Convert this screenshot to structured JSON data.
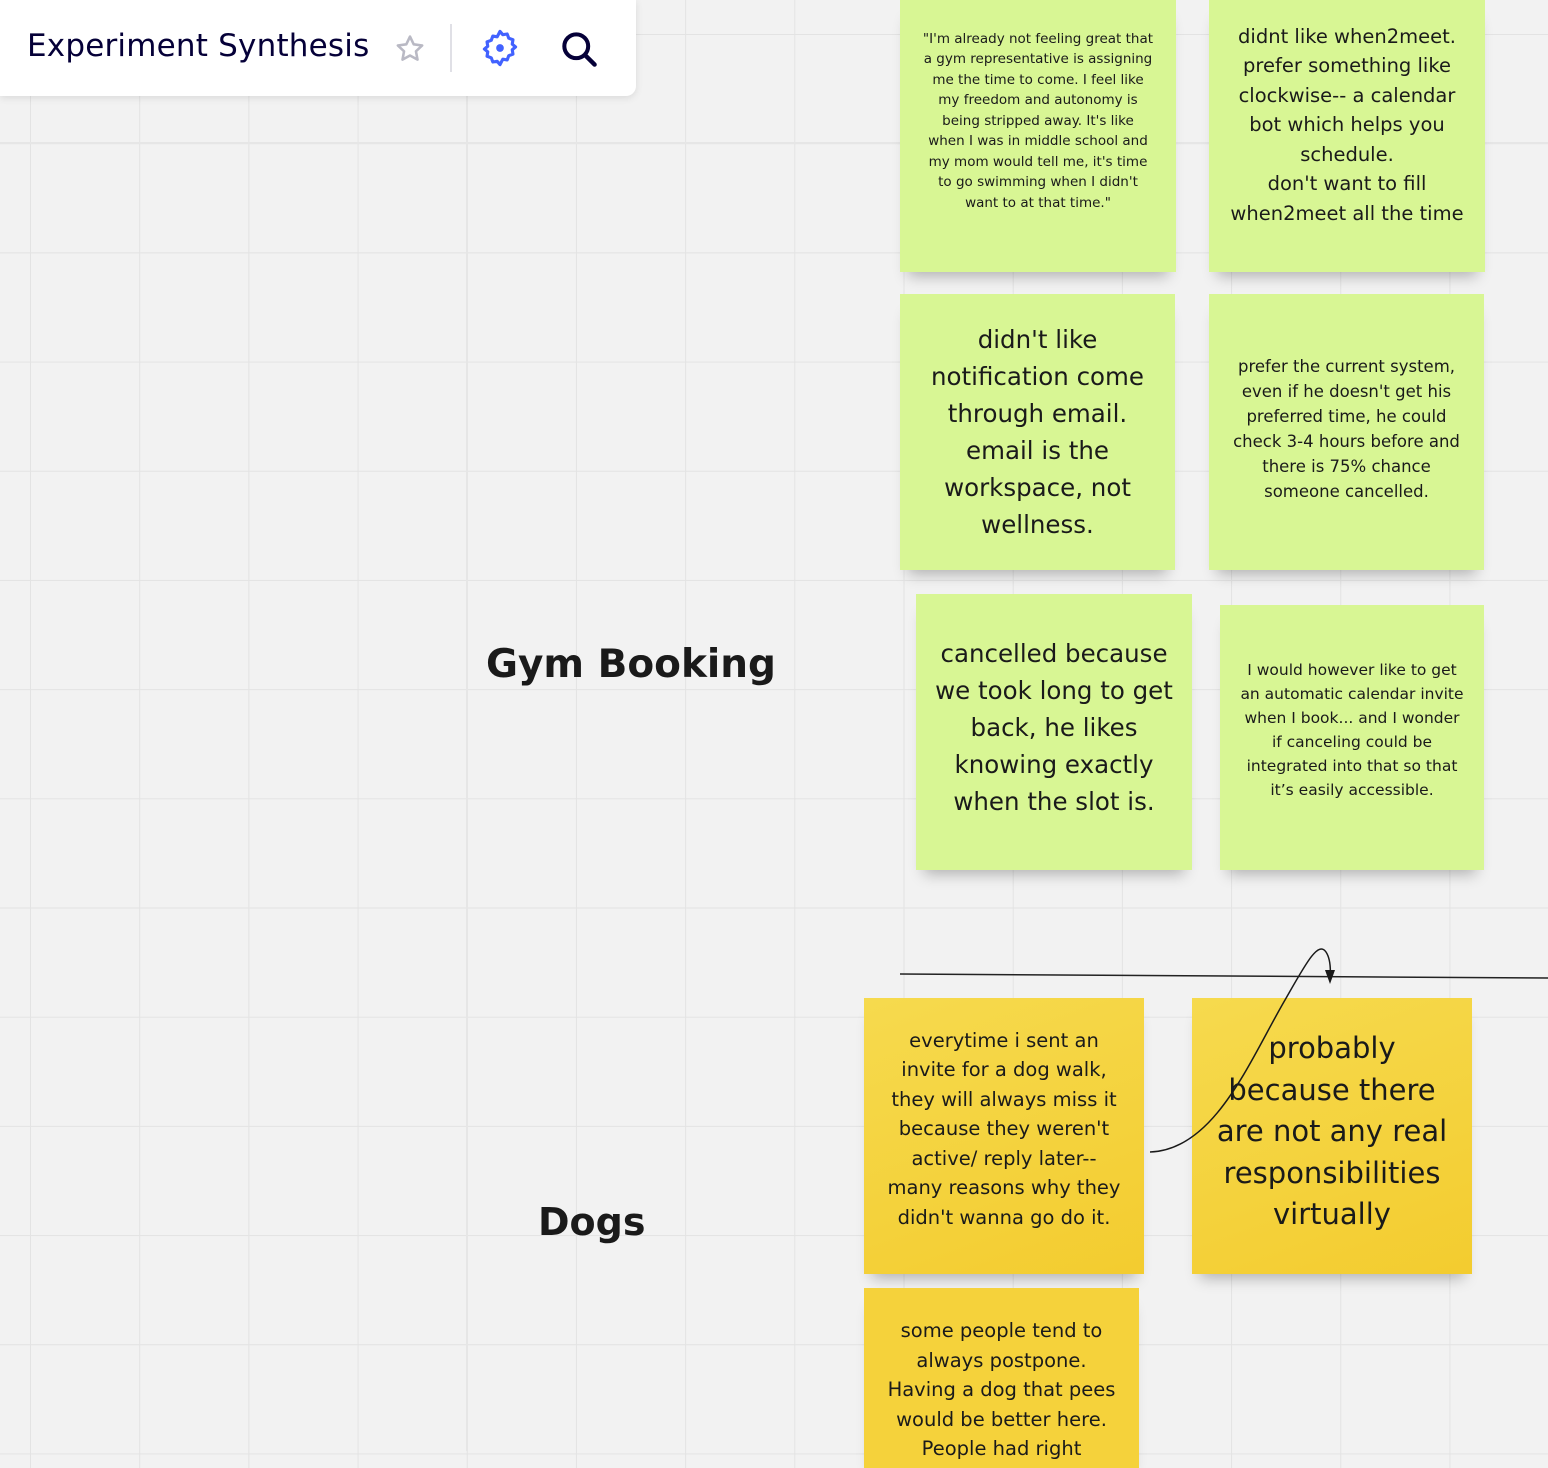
{
  "toolbar": {
    "title": "Experiment Synthesis",
    "icons": {
      "favorite": "star-icon",
      "settings": "gear-icon",
      "search": "search-icon"
    },
    "accent_color": "#4262ff",
    "title_color": "#050038"
  },
  "sections": {
    "gym": {
      "label": "Gym Booking"
    },
    "dogs": {
      "label": "Dogs"
    }
  },
  "stickies": {
    "gym_1": "\"I'm already not feeling great that a gym representative is assigning me the time to come. I feel like my freedom and autonomy is being stripped away. It's like when I was in middle school and my mom would tell me, it's time to go swimming when I didn't want to at that time.\"",
    "gym_2": "didnt like when2meet. prefer something like clockwise-- a calendar bot which helps you schedule.\ndon't want to fill when2meet all the time",
    "gym_3": "didn't like notification come through email. email is the workspace, not wellness.",
    "gym_4": "prefer the current system, even if he doesn't get his preferred time, he could check 3-4 hours before and there is 75% chance someone cancelled.",
    "gym_5": "cancelled because we took long to get back, he likes knowing exactly when the slot is.",
    "gym_6": "I would however like to get an automatic calendar invite when I book... and I wonder if canceling could be integrated into that so that it’s easily accessible.",
    "dogs_1": "everytime i sent an invite for a dog walk, they will always miss it because they weren't active/ reply later-- many reasons why they didn't wanna go do it.",
    "dogs_2": "probably because there are not any real responsibilities virtually",
    "dogs_3": "some people tend to always postpone. Having a dog that pees would be better here. People had right"
  },
  "colors": {
    "green_sticky": "#d8f694",
    "yellow_sticky": "#f5d23b",
    "canvas": "#f2f2f2"
  }
}
